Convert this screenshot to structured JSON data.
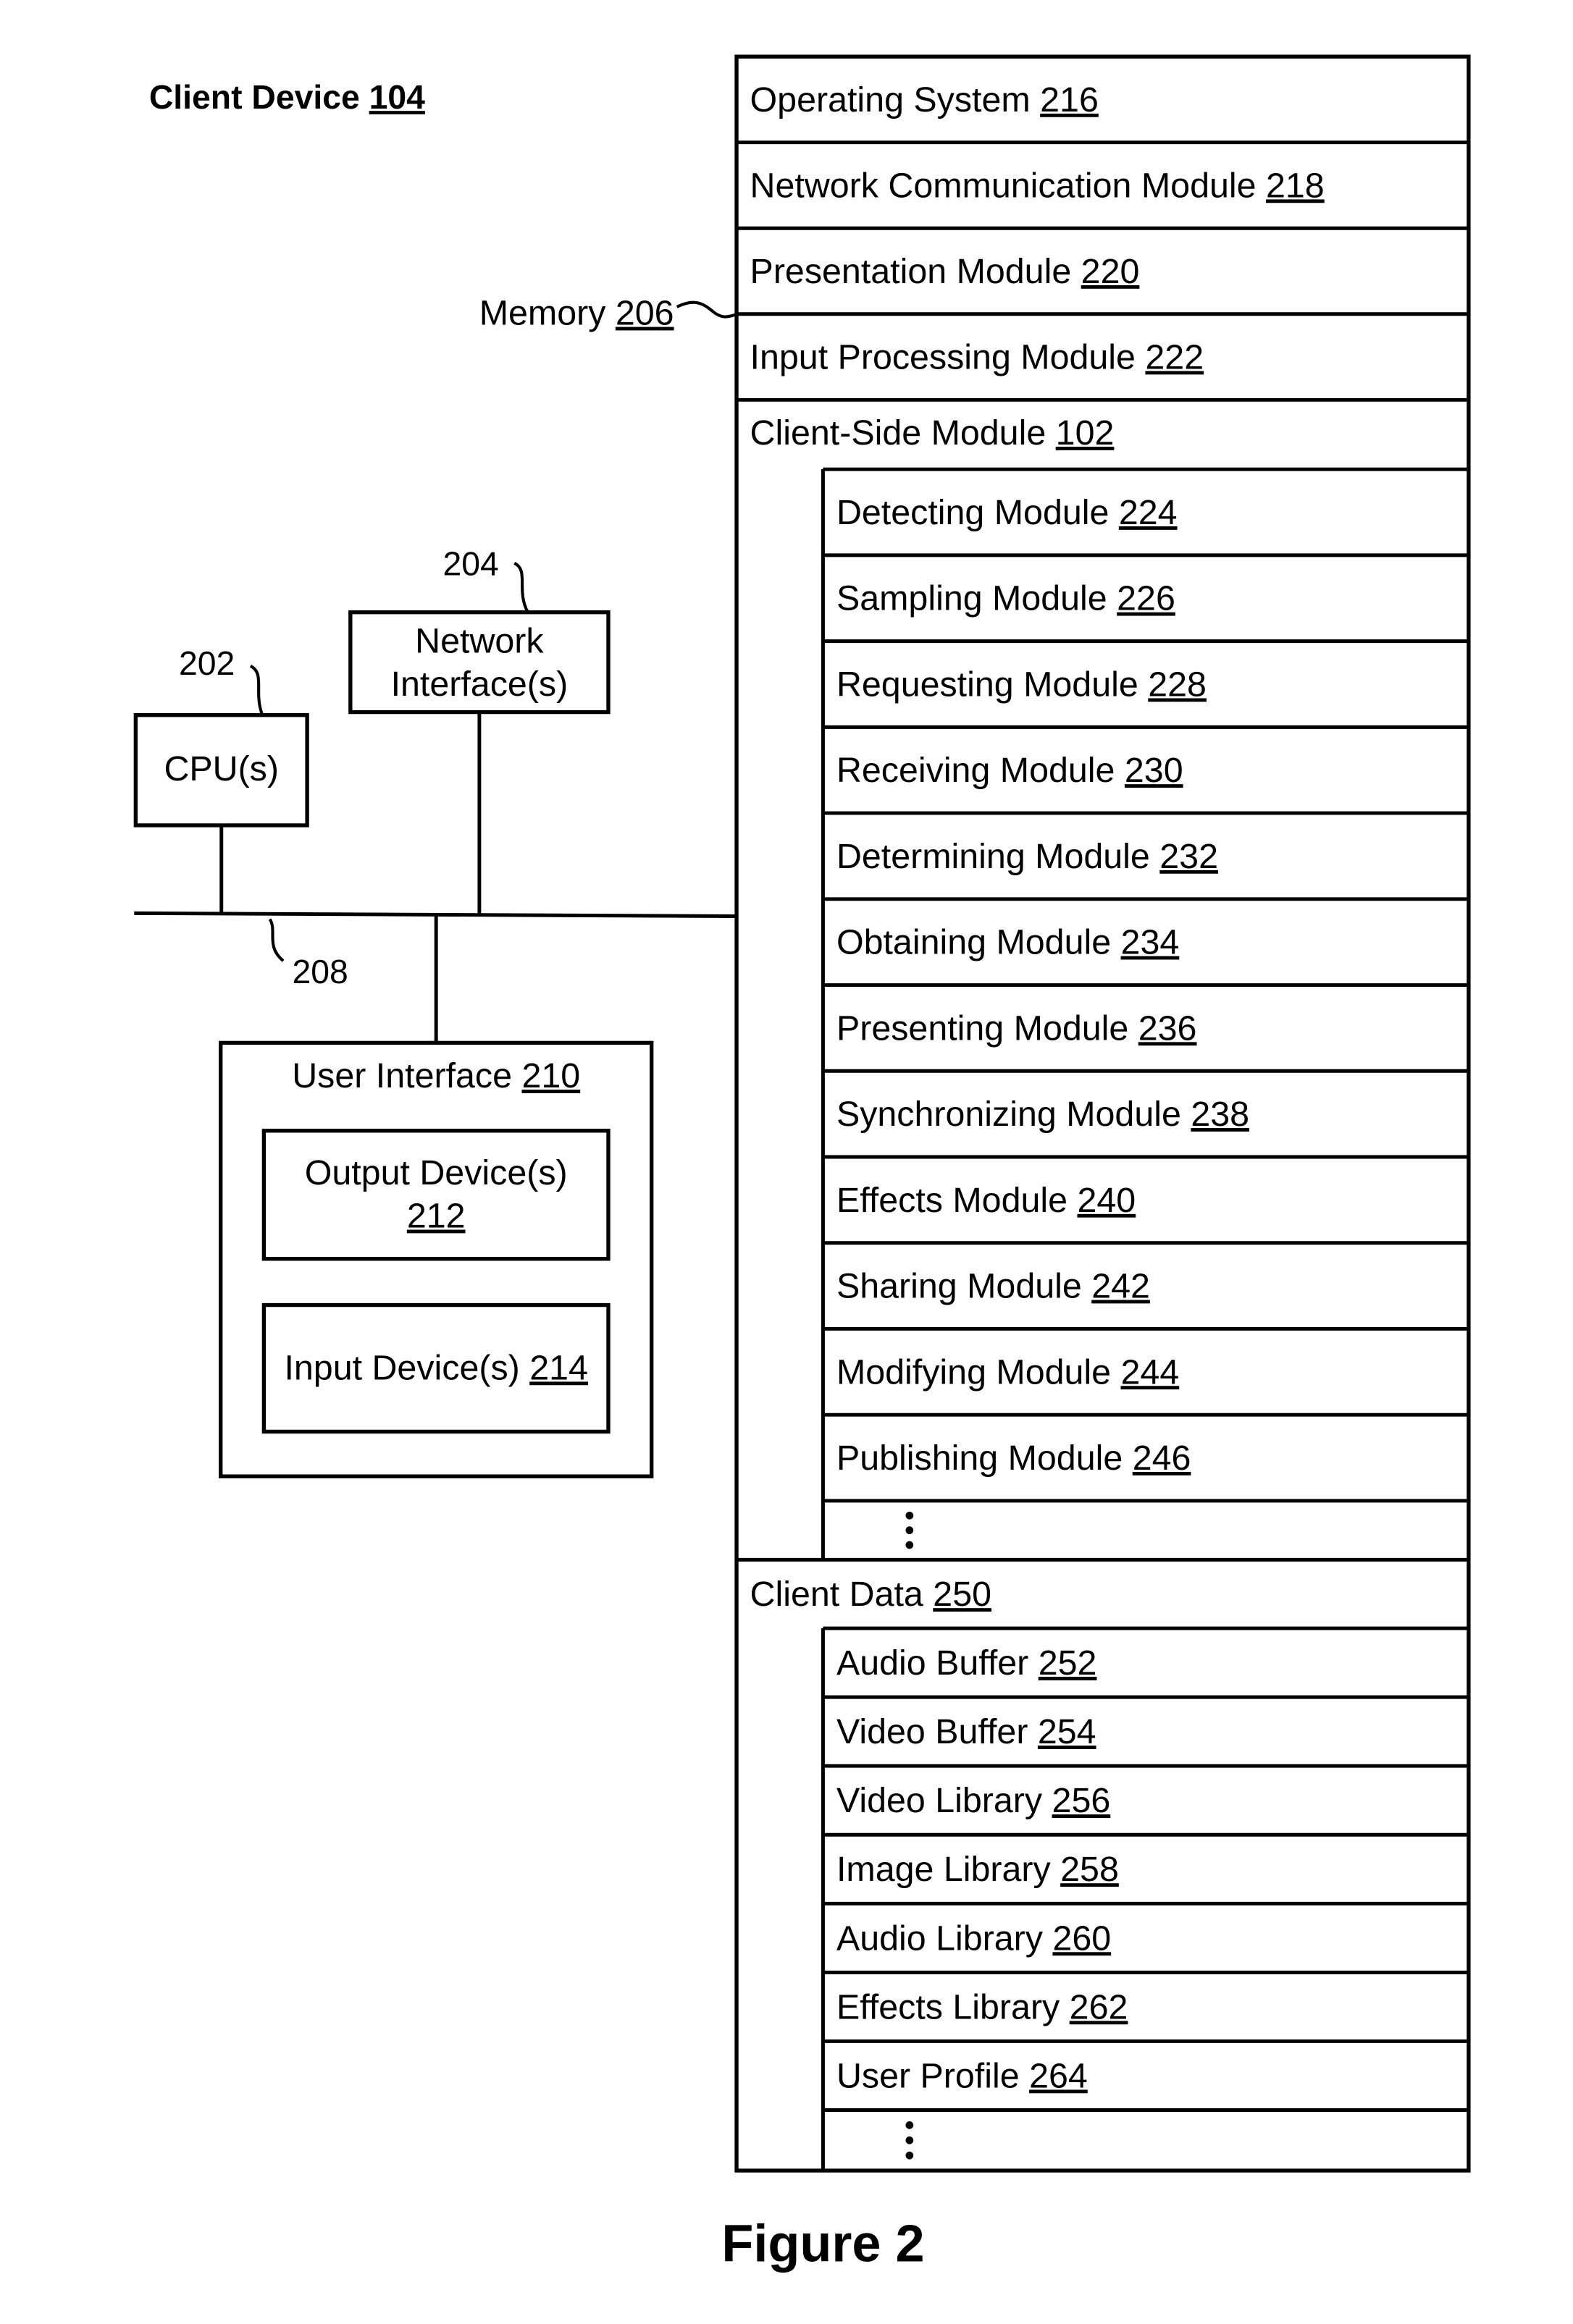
{
  "title": {
    "text": "Client Device",
    "ref": "104"
  },
  "caption": "Figure 2",
  "memory": {
    "label": "Memory",
    "ref": "206"
  },
  "cpu": {
    "label": "CPU(s)",
    "ref": "202"
  },
  "network_interface": {
    "line1": "Network",
    "line2": "Interface(s)",
    "ref": "204"
  },
  "bus": {
    "ref": "208"
  },
  "user_interface": {
    "label": "User Interface",
    "ref": "210",
    "output": {
      "label": "Output Device(s)",
      "ref": "212"
    },
    "input": {
      "label": "Input Device(s)",
      "ref": "214"
    }
  },
  "memory_rows": [
    {
      "label": "Operating System",
      "ref": "216"
    },
    {
      "label": "Network Communication Module",
      "ref": "218"
    },
    {
      "label": "Presentation Module",
      "ref": "220"
    },
    {
      "label": "Input Processing Module",
      "ref": "222"
    }
  ],
  "client_side_module": {
    "label": "Client-Side Module",
    "ref": "102",
    "items": [
      {
        "label": "Detecting Module",
        "ref": "224"
      },
      {
        "label": "Sampling Module",
        "ref": "226"
      },
      {
        "label": "Requesting Module",
        "ref": "228"
      },
      {
        "label": "Receiving Module",
        "ref": "230"
      },
      {
        "label": "Determining Module",
        "ref": "232"
      },
      {
        "label": "Obtaining Module",
        "ref": "234"
      },
      {
        "label": "Presenting Module",
        "ref": "236"
      },
      {
        "label": "Synchronizing Module",
        "ref": "238"
      },
      {
        "label": "Effects Module",
        "ref": "240"
      },
      {
        "label": "Sharing Module",
        "ref": "242"
      },
      {
        "label": "Modifying Module",
        "ref": "244"
      },
      {
        "label": "Publishing Module",
        "ref": "246"
      }
    ],
    "more_indicator": "⋮"
  },
  "client_data": {
    "label": "Client Data",
    "ref": "250",
    "items": [
      {
        "label": "Audio Buffer",
        "ref": "252"
      },
      {
        "label": "Video Buffer",
        "ref": "254"
      },
      {
        "label": "Video Library",
        "ref": "256"
      },
      {
        "label": "Image Library",
        "ref": "258"
      },
      {
        "label": "Audio Library",
        "ref": "260"
      },
      {
        "label": "Effects Library",
        "ref": "262"
      },
      {
        "label": "User Profile",
        "ref": "264"
      }
    ],
    "more_indicator": "⋮"
  }
}
